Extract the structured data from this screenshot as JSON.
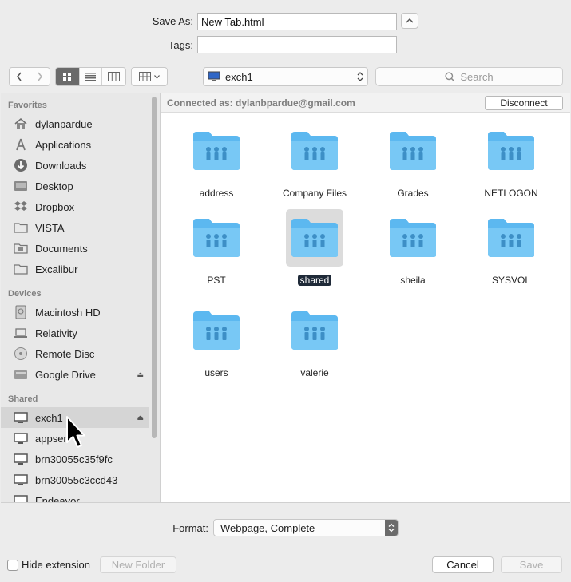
{
  "form": {
    "save_as_label": "Save As:",
    "save_as_value": "New Tab.html",
    "tags_label": "Tags:",
    "tags_value": ""
  },
  "toolbar": {
    "location": "exch1",
    "search_placeholder": "Search"
  },
  "sidebar": {
    "favorites_header": "Favorites",
    "favorites": [
      {
        "label": "dylanpardue",
        "icon": "home-icon"
      },
      {
        "label": "Applications",
        "icon": "applications-icon"
      },
      {
        "label": "Downloads",
        "icon": "downloads-icon"
      },
      {
        "label": "Desktop",
        "icon": "desktop-icon"
      },
      {
        "label": "Dropbox",
        "icon": "dropbox-icon"
      },
      {
        "label": "VISTA",
        "icon": "folder-icon"
      },
      {
        "label": "Documents",
        "icon": "documents-icon"
      },
      {
        "label": "Excalibur",
        "icon": "folder-icon"
      }
    ],
    "devices_header": "Devices",
    "devices": [
      {
        "label": "Macintosh HD",
        "icon": "hard-drive-icon"
      },
      {
        "label": "Relativity",
        "icon": "laptop-icon"
      },
      {
        "label": "Remote Disc",
        "icon": "disc-icon"
      },
      {
        "label": "Google Drive",
        "icon": "google-drive-icon"
      }
    ],
    "shared_header": "Shared",
    "shared": [
      {
        "label": "exch1",
        "icon": "monitor-icon"
      },
      {
        "label": "appser",
        "icon": "monitor-icon"
      },
      {
        "label": "brn30055c35f9fc",
        "icon": "monitor-icon"
      },
      {
        "label": "brn30055c3ccd43",
        "icon": "monitor-icon"
      },
      {
        "label": "Endeavor",
        "icon": "monitor-icon"
      }
    ]
  },
  "main": {
    "connected_text": "Connected as: dylanbpardue@gmail.com",
    "disconnect_label": "Disconnect",
    "folders": [
      "address",
      "Company Files",
      "Grades",
      "NETLOGON",
      "PST",
      "shared",
      "sheila",
      "SYSVOL",
      "users",
      "valerie"
    ],
    "selected_folder": "shared"
  },
  "bottom": {
    "format_label": "Format:",
    "format_value": "Webpage, Complete",
    "hide_extension_label": "Hide extension",
    "new_folder_label": "New Folder",
    "cancel_label": "Cancel",
    "save_label": "Save"
  },
  "colors": {
    "folder_blue": "#5cb8f0",
    "selection_dark": "#1f2a38"
  }
}
